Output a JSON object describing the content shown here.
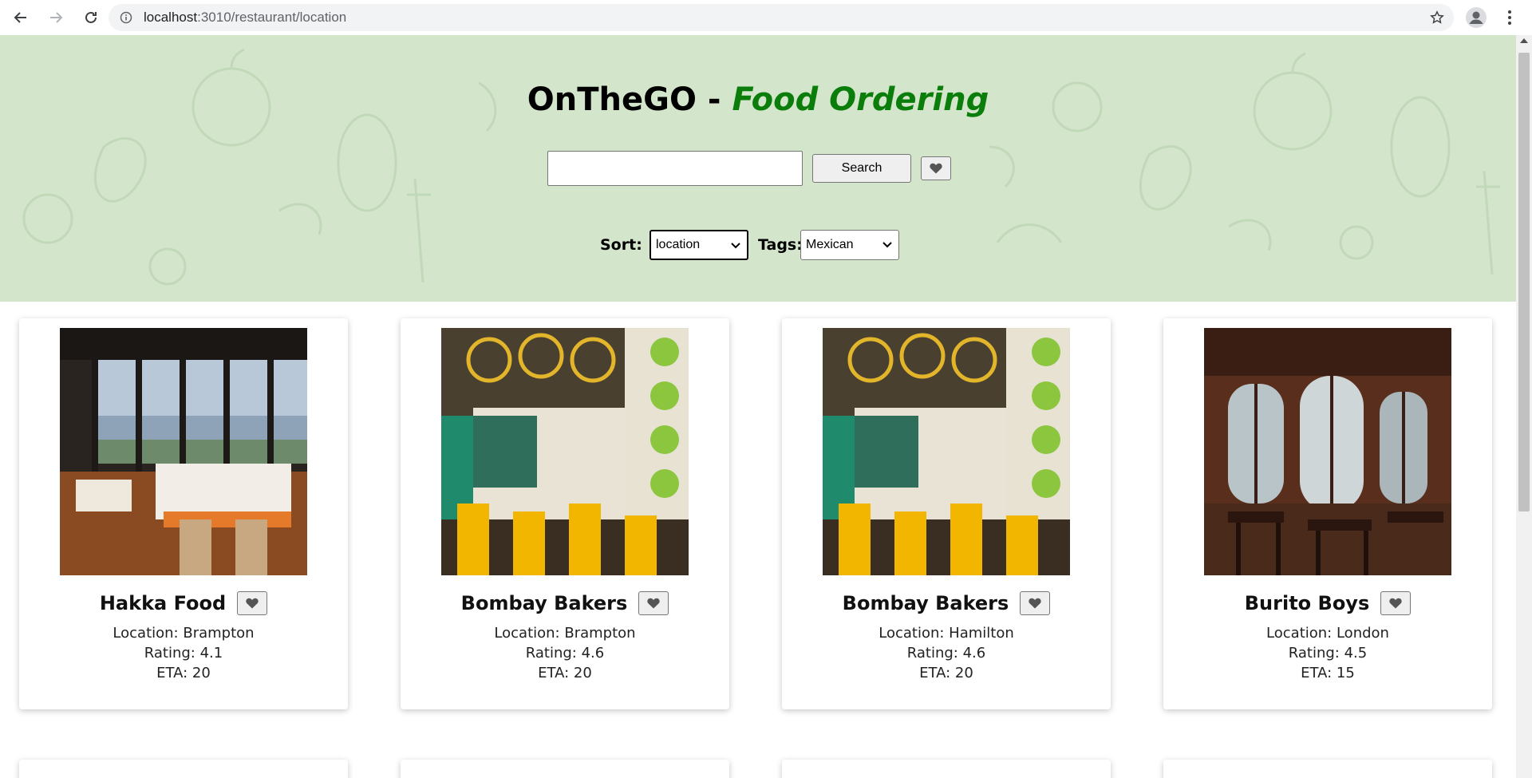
{
  "browser": {
    "url_host": "localhost",
    "url_path": ":3010/restaurant/location"
  },
  "hero": {
    "title_main": "OnTheGO -",
    "title_accent": "Food Ordering",
    "search_value": "",
    "search_button": "Search"
  },
  "filters": {
    "sort_label": "Sort:",
    "sort_value": "location",
    "tags_label": "Tags:",
    "tags_value": "Mexican"
  },
  "restaurants": [
    {
      "name": "Hakka Food",
      "location": "Location: Brampton",
      "rating": "Rating: 4.1",
      "eta": "ETA: 20"
    },
    {
      "name": "Bombay Bakers",
      "location": "Location: Brampton",
      "rating": "Rating: 4.6",
      "eta": "ETA: 20"
    },
    {
      "name": "Bombay Bakers",
      "location": "Location: Hamilton",
      "rating": "Rating: 4.6",
      "eta": "ETA: 20"
    },
    {
      "name": "Burito Boys",
      "location": "Location: London",
      "rating": "Rating: 4.5",
      "eta": "ETA: 15"
    }
  ],
  "colors": {
    "hero_bg": "#d3e6cb",
    "accent_green": "#0a7d0a"
  },
  "icons": {
    "favorite": "heart-icon",
    "back": "arrow-left-icon",
    "forward": "arrow-right-icon",
    "reload": "reload-icon",
    "info": "info-icon",
    "bookmark": "star-icon",
    "profile": "profile-icon",
    "menu": "kebab-menu-icon"
  }
}
